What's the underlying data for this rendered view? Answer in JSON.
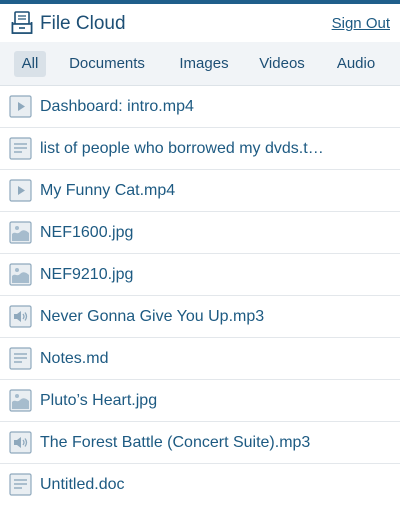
{
  "app": {
    "title": "File Cloud",
    "sign_out_label": "Sign Out"
  },
  "tabs": [
    {
      "label": "All",
      "active": true
    },
    {
      "label": "Documents",
      "active": false
    },
    {
      "label": "Images",
      "active": false
    },
    {
      "label": "Videos",
      "active": false
    },
    {
      "label": "Audio",
      "active": false
    }
  ],
  "files": [
    {
      "name": "Dashboard: intro.mp4",
      "icon": "video-file-icon"
    },
    {
      "name": "list of people who borrowed my dvds.t…",
      "icon": "document-file-icon"
    },
    {
      "name": "My Funny Cat.mp4",
      "icon": "video-file-icon"
    },
    {
      "name": "NEF1600.jpg",
      "icon": "image-file-icon"
    },
    {
      "name": "NEF9210.jpg",
      "icon": "image-file-icon"
    },
    {
      "name": "Never Gonna Give You Up.mp3",
      "icon": "audio-file-icon"
    },
    {
      "name": "Notes.md",
      "icon": "document-file-icon"
    },
    {
      "name": "Pluto’s Heart.jpg",
      "icon": "image-file-icon"
    },
    {
      "name": "The Forest Battle (Concert Suite).mp3",
      "icon": "audio-file-icon"
    },
    {
      "name": "Untitled.doc",
      "icon": "document-file-icon"
    }
  ],
  "colors": {
    "accent": "#1f5f8b",
    "text": "#1d5a82",
    "tabbar_bg": "#f1f4f7",
    "active_tab_bg": "#d9e1e8",
    "icon_fill": "#e9eef2",
    "icon_stroke": "#8fa9bd"
  }
}
